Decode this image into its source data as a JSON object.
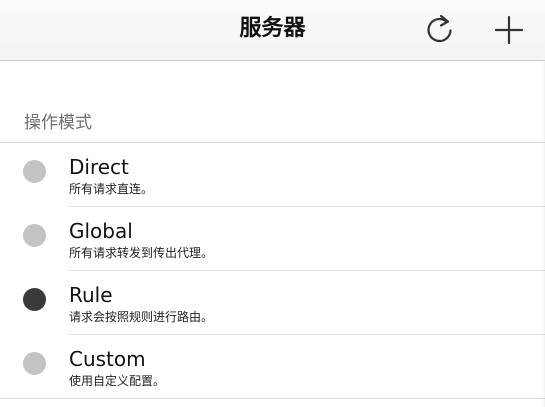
{
  "navbar": {
    "title": "服务器",
    "refresh_icon": "refresh-icon",
    "add_icon": "plus-icon"
  },
  "section": {
    "header": "操作模式"
  },
  "modes": [
    {
      "title": "Direct",
      "subtitle": "所有请求直连。",
      "selected": false
    },
    {
      "title": "Global",
      "subtitle": "所有请求转发到传出代理。",
      "selected": false
    },
    {
      "title": "Rule",
      "subtitle": "请求会按照规则进行路由。",
      "selected": true
    },
    {
      "title": "Custom",
      "subtitle": "使用自定义配置。",
      "selected": false
    }
  ],
  "colors": {
    "radio_unselected": "#c4c4c4",
    "radio_selected": "#3a3a3a"
  }
}
